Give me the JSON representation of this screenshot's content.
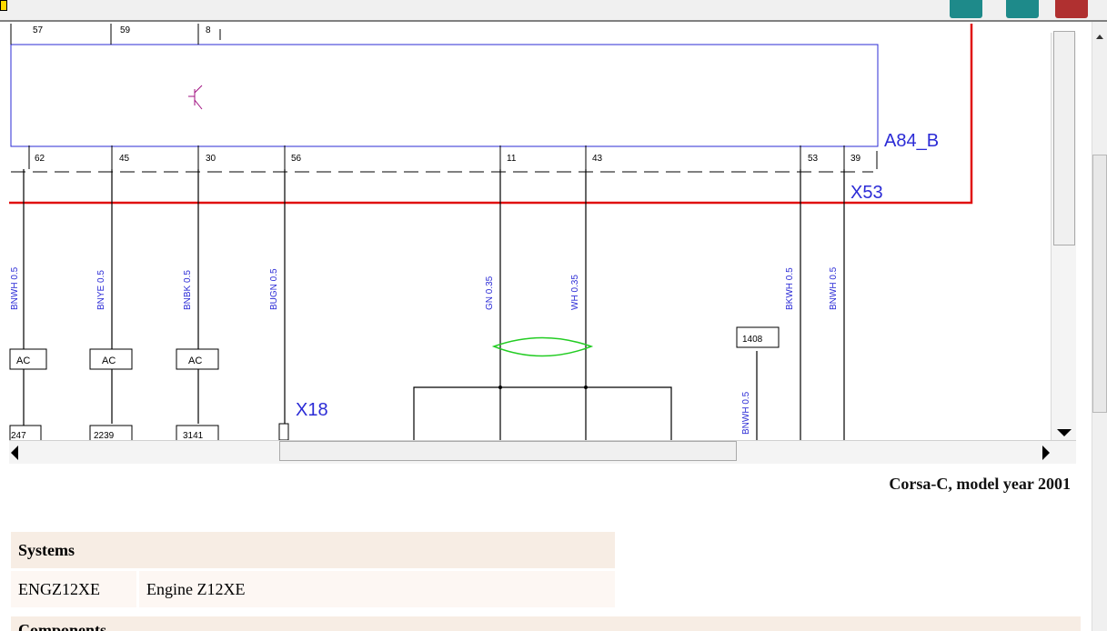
{
  "toolbar": {
    "buttons": [
      {
        "name": "tool-a"
      },
      {
        "name": "tool-b"
      },
      {
        "name": "tool-c"
      }
    ]
  },
  "diagram": {
    "top_pins": [
      "57",
      "59",
      "8"
    ],
    "bottom_pins": [
      "62",
      "45",
      "30",
      "56",
      "11",
      "43",
      "53",
      "39"
    ],
    "connector_a": "A84_B",
    "connector_x53": "X53",
    "connector_x18": "X18",
    "wire_labels": [
      "BNWH 0.5",
      "BNYE 0.5",
      "BNBK 0.5",
      "BUGN 0.5",
      "GN 0.35",
      "WH 0.35",
      "BKWH 0.5",
      "BNWH 0.5",
      "BNWH 0.5"
    ],
    "ac_boxes": [
      "AC",
      "AC",
      "AC"
    ],
    "lower_boxes": [
      "247",
      "2239",
      "3141"
    ],
    "ref_box": "1408",
    "colors": {
      "frame": "#2b2bd6",
      "power": "#e01010",
      "twist": "#22cc22",
      "symbol": "#a01080"
    }
  },
  "caption": "Corsa-C, model year 2001",
  "systems": {
    "header": "Systems",
    "rows": [
      {
        "code": "ENGZ12XE",
        "name": "Engine Z12XE"
      }
    ]
  },
  "components": {
    "header": "Components"
  }
}
